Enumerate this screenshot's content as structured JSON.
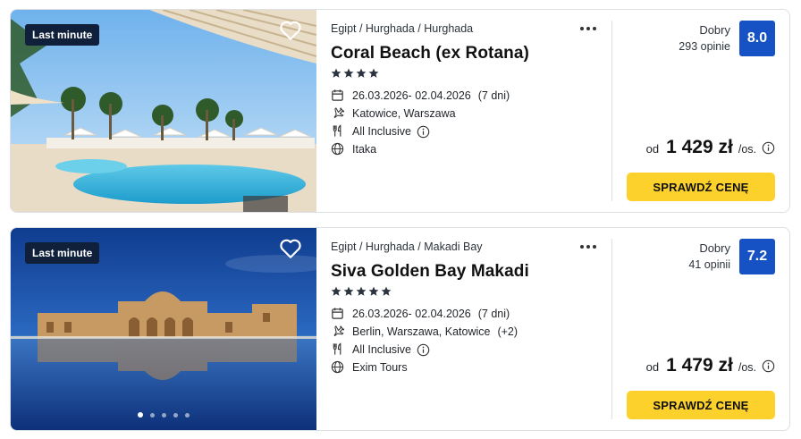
{
  "offers": [
    {
      "badge": "Last minute",
      "breadcrumb": "Egipt / Hurghada / Hurghada",
      "name": "Coral Beach (ex Rotana)",
      "stars": 4,
      "dates": "26.03.2026- 02.04.2026",
      "duration": "(7 dni)",
      "departure": "Katowice, Warszawa",
      "departure_extra": "",
      "board": "All Inclusive",
      "operator": "Itaka",
      "rating_word": "Dobry",
      "rating_count": "293 opinie",
      "score": "8.0",
      "price_prefix": "od",
      "price": "1 429 zł",
      "price_suffix": "/os.",
      "cta": "SPRAWDŹ CENĘ",
      "carousel_active": 0,
      "carousel_count": 0
    },
    {
      "badge": "Last minute",
      "breadcrumb": "Egipt / Hurghada / Makadi Bay",
      "name": "Siva Golden Bay Makadi",
      "stars": 5,
      "dates": "26.03.2026- 02.04.2026",
      "duration": "(7 dni)",
      "departure": "Berlin, Warszawa, Katowice",
      "departure_extra": "(+2)",
      "board": "All Inclusive",
      "operator": "Exim Tours",
      "rating_word": "Dobry",
      "rating_count": "41 opinii",
      "score": "7.2",
      "price_prefix": "od",
      "price": "1 479 zł",
      "price_suffix": "/os.",
      "cta": "SPRAWDŹ CENĘ",
      "carousel_active": 0,
      "carousel_count": 5
    }
  ],
  "colors": {
    "badge_bg": "#10203b",
    "score_bg": "#1652c4",
    "cta_bg": "#fcd12b"
  },
  "icons": {
    "favorite": "heart-outline-icon",
    "more": "more-horizontal-icon",
    "dates": "calendar-icon",
    "departure": "plane-icon",
    "board": "cutlery-icon",
    "operator": "globe-icon",
    "info": "info-circle-icon",
    "stars": "star-icon"
  }
}
